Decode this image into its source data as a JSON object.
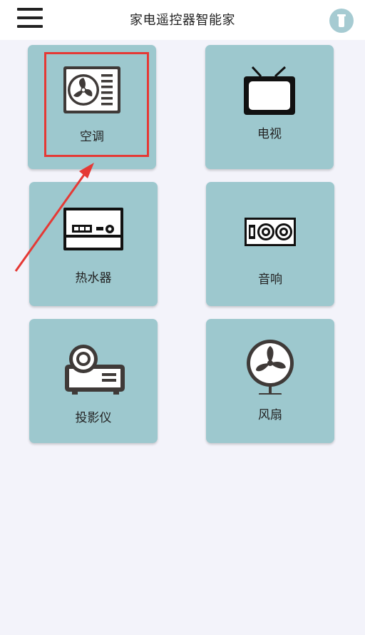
{
  "header": {
    "title": "家电遥控器智能家",
    "menu_icon": "menu-icon",
    "profile_icon": "profile-icon"
  },
  "devices": [
    {
      "id": "ac",
      "label": "空调",
      "icon": "air-conditioner-icon"
    },
    {
      "id": "tv",
      "label": "电视",
      "icon": "tv-icon"
    },
    {
      "id": "water-heater",
      "label": "热水器",
      "icon": "water-heater-icon"
    },
    {
      "id": "audio",
      "label": "音响",
      "icon": "speaker-icon"
    },
    {
      "id": "projector",
      "label": "投影仪",
      "icon": "projector-icon"
    },
    {
      "id": "fan",
      "label": "风扇",
      "icon": "fan-icon"
    }
  ],
  "colors": {
    "card_bg": "#9dc8ce",
    "page_bg": "#f3f3fa",
    "highlight": "#e53935",
    "icon_stroke": "#3f3a38"
  }
}
